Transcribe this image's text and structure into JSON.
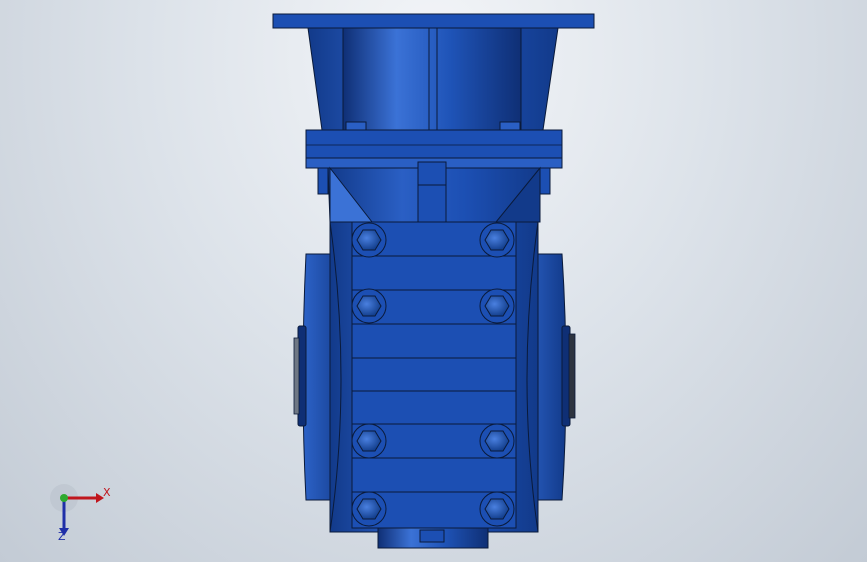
{
  "viewport": {
    "background": [
      "#f3f5f8",
      "#c3cbd5"
    ],
    "model": {
      "name": "gear-reducer-assembly",
      "body_color": "#1c4fb3",
      "shade_color": "#123a8a",
      "highlight_color": "#3b72d6",
      "edge_color": "#0a1a3a"
    },
    "triad": {
      "x_label": "X",
      "z_label": "Z",
      "x_color": "#c0161d",
      "y_color": "#2faa2f",
      "z_color": "#1f2fa8"
    }
  }
}
